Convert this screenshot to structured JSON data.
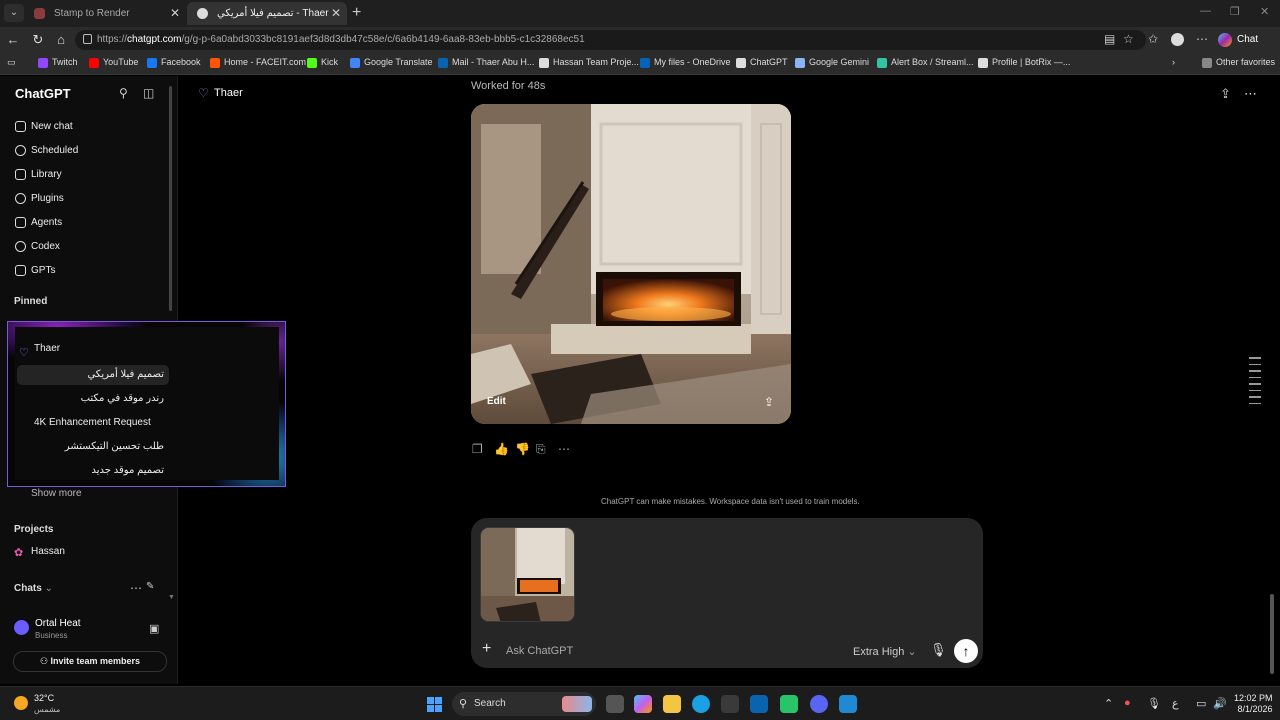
{
  "browser": {
    "tabs": [
      {
        "title": "Stamp to Render"
      },
      {
        "title": "تصميم فيلا أمريكي - Thaer"
      }
    ],
    "url_prefix": "https://",
    "url_host": "chatgpt.com",
    "url_path": "/g/g-p-6a0abd3033bc8191aef3d8d3db47c58e/c/6a6b4149-6aa8-83eb-bbb5-c1c32868ec51",
    "chat_button": "Chat",
    "favorites": [
      {
        "label": "Twitch",
        "color": "#9146ff"
      },
      {
        "label": "YouTube",
        "color": "#ff0000"
      },
      {
        "label": "Facebook",
        "color": "#1877f2"
      },
      {
        "label": "Home - FACEIT.com",
        "color": "#ff5500"
      },
      {
        "label": "Kick",
        "color": "#53fc18"
      },
      {
        "label": "Google Translate",
        "color": "#4285f4"
      },
      {
        "label": "Mail - Thaer Abu H...",
        "color": "#0a64ad"
      },
      {
        "label": "Hassan Team Proje...",
        "color": "#dddddd"
      },
      {
        "label": "My files - OneDrive",
        "color": "#0364b8"
      },
      {
        "label": "ChatGPT",
        "color": "#dddddd"
      },
      {
        "label": "Google Gemini",
        "color": "#8ab4f8"
      },
      {
        "label": "Alert Box / Streaml...",
        "color": "#31c3a2"
      },
      {
        "label": "Profile | BotRix —...",
        "color": "#dddddd"
      }
    ],
    "other_favorites": "Other favorites"
  },
  "sidebar": {
    "title": "ChatGPT",
    "nav": [
      {
        "label": "New chat",
        "icon": "edit-icon"
      },
      {
        "label": "Scheduled",
        "icon": "clock-icon"
      },
      {
        "label": "Library",
        "icon": "library-icon"
      },
      {
        "label": "Plugins",
        "icon": "plugins-icon"
      },
      {
        "label": "Agents",
        "icon": "agents-icon"
      },
      {
        "label": "Codex",
        "icon": "codex-icon"
      },
      {
        "label": "GPTs",
        "icon": "gpts-icon"
      }
    ],
    "pinned_label": "Pinned",
    "pinned_items": [
      {
        "label": "Thaer"
      },
      {
        "label": "تصميم فيلا أمريكي"
      },
      {
        "label": "رندر موقد في مكتب"
      },
      {
        "label": "4K Enhancement Request"
      },
      {
        "label": "طلب تحسين التيكستشر"
      },
      {
        "label": "تصميم موقد جديد"
      }
    ],
    "show_more": "Show more",
    "projects_label": "Projects",
    "project_item": "Hassan",
    "chats_label": "Chats",
    "user_name": "Ortal Heat",
    "user_plan": "Business",
    "invite_label": "Invite team members"
  },
  "main": {
    "project_title": "Thaer",
    "worked_for": "Worked for 48s",
    "image_edit": "Edit",
    "disclaimer": "ChatGPT can make mistakes. Workspace data isn't used to train models.",
    "composer_placeholder": "Ask ChatGPT",
    "mode": "Extra High"
  },
  "taskbar": {
    "temperature": "32°C",
    "condition": "مشمس",
    "search": "Search",
    "time": "12:02 PM",
    "date": "8/1/2026",
    "lang": "ع"
  }
}
